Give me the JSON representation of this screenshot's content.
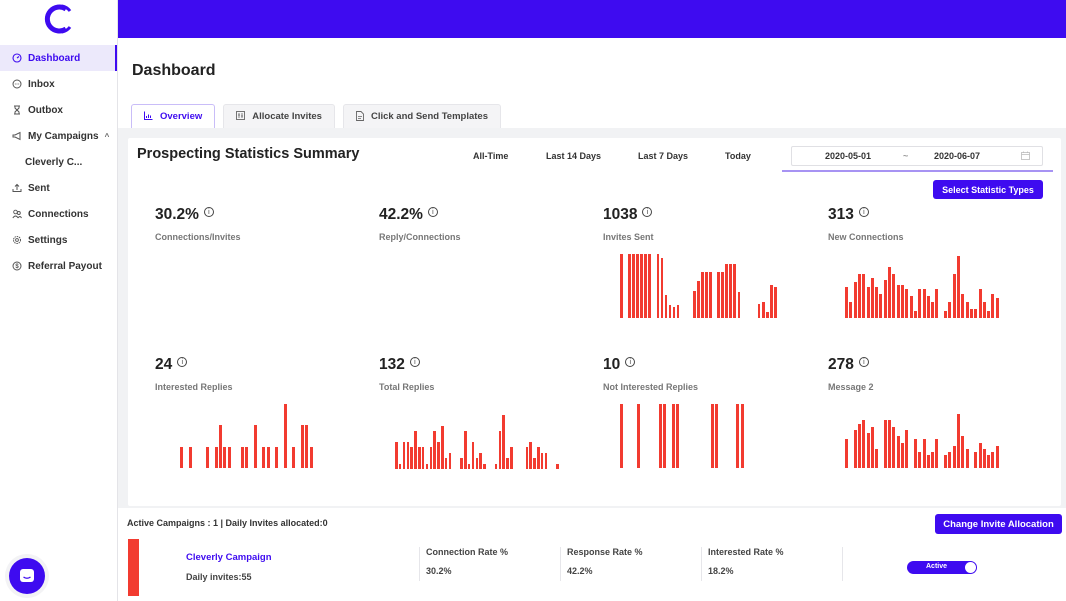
{
  "app": {
    "brand_color": "#3e0bf0",
    "bar_color": "#f23b30"
  },
  "sidebar": {
    "items": [
      {
        "label": "Dashboard",
        "icon": "gauge-icon",
        "active": true
      },
      {
        "label": "Inbox",
        "icon": "chat-bubble-icon"
      },
      {
        "label": "Outbox",
        "icon": "hourglass-icon"
      },
      {
        "label": "My Campaigns",
        "icon": "megaphone-icon",
        "expanded": true
      },
      {
        "label": "Cleverly C...",
        "sub": true
      },
      {
        "label": "Sent",
        "icon": "upload-icon"
      },
      {
        "label": "Connections",
        "icon": "users-icon"
      },
      {
        "label": "Settings",
        "icon": "gear-icon"
      },
      {
        "label": "Referral Payout",
        "icon": "dollar-circle-icon"
      }
    ]
  },
  "header": {
    "title": "Dashboard"
  },
  "tabs": [
    {
      "label": "Overview",
      "icon": "bar-chart-icon",
      "active": true
    },
    {
      "label": "Allocate Invites",
      "icon": "sliders-icon"
    },
    {
      "label": "Click and Send Templates",
      "icon": "document-icon"
    }
  ],
  "stats": {
    "title": "Prospecting Statistics Summary",
    "ranges": [
      "All-Time",
      "Last 14 Days",
      "Last 7 Days",
      "Today"
    ],
    "date_from": "2020-05-01",
    "date_sep": "~",
    "date_to": "2020-06-07",
    "select_types_label": "Select Statistic Types",
    "metrics": [
      {
        "value": "30.2%",
        "label": "Connections/Invites"
      },
      {
        "value": "42.2%",
        "label": "Reply/Connections"
      },
      {
        "value": "1038",
        "label": "Invites Sent"
      },
      {
        "value": "313",
        "label": "New Connections"
      },
      {
        "value": "24",
        "label": "Interested Replies"
      },
      {
        "value": "132",
        "label": "Total Replies"
      },
      {
        "value": "10",
        "label": "Not Interested Replies"
      },
      {
        "value": "278",
        "label": "Message 2"
      }
    ]
  },
  "chart_data": [
    {
      "type": "bar",
      "title": "Invites Sent",
      "xlabel": "",
      "ylabel": "",
      "values": [
        60,
        0,
        60,
        60,
        60,
        60,
        60,
        60,
        0,
        60,
        56,
        22,
        12,
        10,
        12,
        0,
        0,
        0,
        25,
        35,
        43,
        43,
        43,
        0,
        43,
        43,
        51,
        51,
        51,
        24,
        0,
        0,
        0,
        0,
        13,
        15,
        6,
        31,
        29
      ]
    },
    {
      "type": "bar",
      "title": "New Connections",
      "xlabel": "",
      "ylabel": "",
      "values": [
        17,
        9,
        20,
        24,
        24,
        17,
        22,
        17,
        13,
        21,
        28,
        24,
        18,
        18,
        16,
        12,
        4,
        16,
        16,
        12,
        9,
        16,
        0,
        4,
        9,
        24,
        34,
        13,
        9,
        5,
        5,
        16,
        9,
        4,
        13,
        11
      ]
    },
    {
      "type": "bar",
      "title": "Interested Replies",
      "xlabel": "",
      "ylabel": "",
      "values": [
        1,
        0,
        1,
        0,
        0,
        0,
        1,
        0,
        1,
        2,
        1,
        1,
        0,
        0,
        1,
        1,
        0,
        2,
        0,
        1,
        1,
        0,
        1,
        0,
        3,
        0,
        1,
        0,
        2,
        2,
        1
      ]
    },
    {
      "type": "bar",
      "title": "Total Replies",
      "xlabel": "",
      "ylabel": "",
      "values": [
        5,
        1,
        5,
        5,
        4,
        7,
        4,
        4,
        1,
        4,
        7,
        5,
        8,
        2,
        3,
        0,
        0,
        2,
        7,
        1,
        5,
        2,
        3,
        1,
        0,
        0,
        1,
        7,
        10,
        2,
        4,
        0,
        0,
        0,
        4,
        5,
        2,
        4,
        3,
        3,
        0,
        0,
        1
      ]
    },
    {
      "type": "bar",
      "title": "Not Interested Replies",
      "xlabel": "",
      "ylabel": "",
      "values": [
        1,
        0,
        0,
        0,
        1,
        0,
        0,
        0,
        0,
        1,
        1,
        0,
        1,
        1,
        0,
        0,
        0,
        0,
        0,
        0,
        0,
        1,
        1,
        0,
        0,
        0,
        0,
        1,
        1
      ]
    },
    {
      "type": "bar",
      "title": "Message 2",
      "xlabel": "",
      "ylabel": "",
      "values": [
        9,
        0,
        12,
        14,
        15,
        11,
        13,
        6,
        0,
        15,
        15,
        13,
        10,
        8,
        12,
        0,
        9,
        5,
        9,
        4,
        5,
        9,
        0,
        4,
        5,
        7,
        17,
        10,
        6,
        0,
        5,
        8,
        6,
        4,
        5,
        7
      ]
    }
  ],
  "campaigns": {
    "summary": "Active Campaigns : 1 | Daily Invites allocated:0",
    "change_allocation_label": "Change Invite Allocation",
    "rows": [
      {
        "name": "Cleverly Campaign",
        "daily_invites": "Daily invites:55",
        "connection_rate_label": "Connection Rate %",
        "connection_rate": "30.2%",
        "response_rate_label": "Response Rate %",
        "response_rate": "42.2%",
        "interested_rate_label": "Interested Rate %",
        "interested_rate": "18.2%",
        "status": "Active"
      }
    ]
  }
}
